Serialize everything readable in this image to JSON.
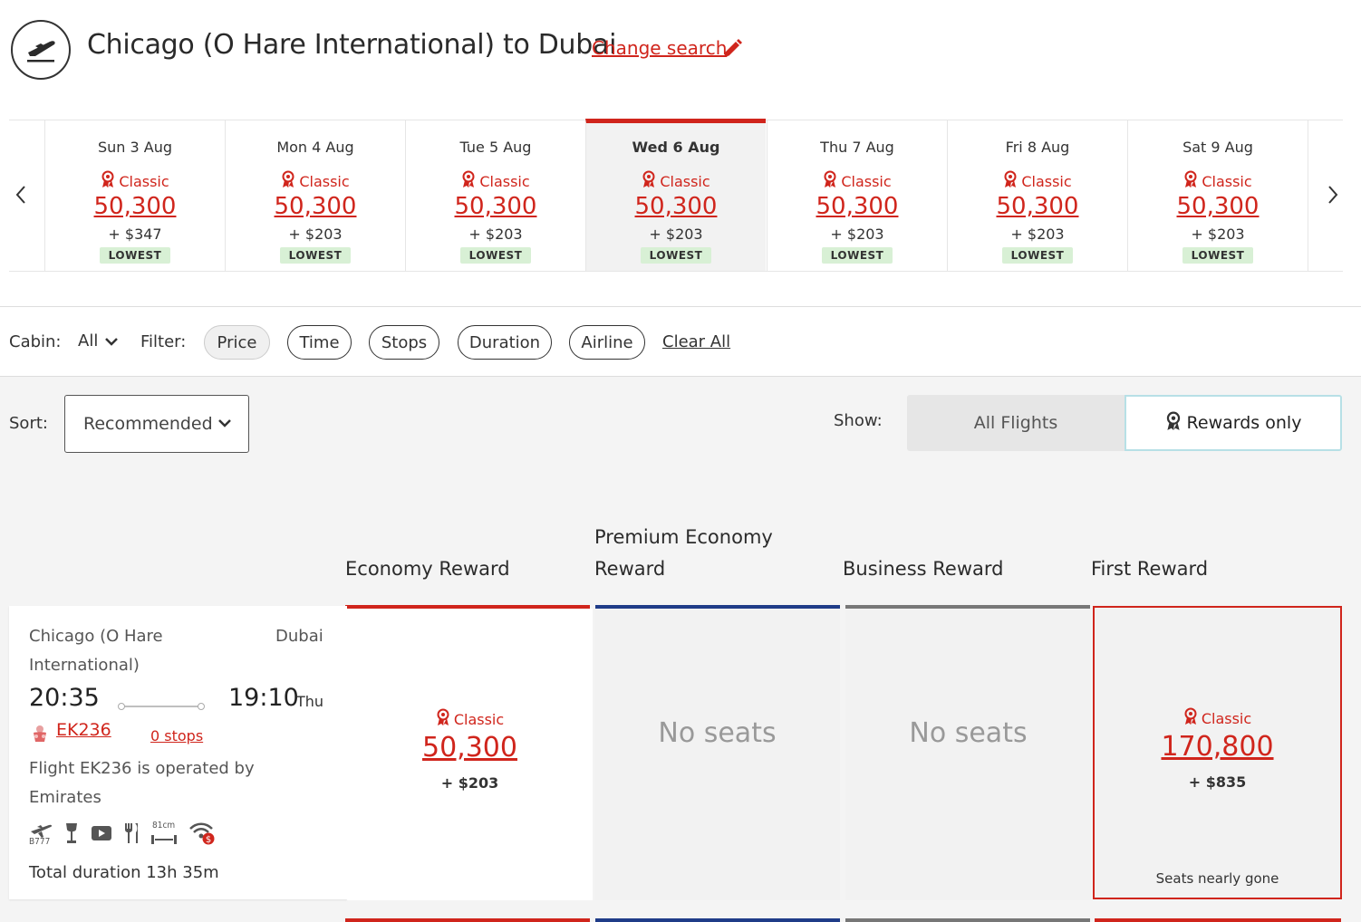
{
  "header": {
    "title": "Chicago (O Hare International) to Dubai",
    "change_search": "Change search"
  },
  "dates": [
    {
      "label": "Sun 3 Aug",
      "award": "Classic",
      "points": "50,300",
      "tax": "+ $347",
      "badge": "LOWEST",
      "selected": false
    },
    {
      "label": "Mon 4 Aug",
      "award": "Classic",
      "points": "50,300",
      "tax": "+ $203",
      "badge": "LOWEST",
      "selected": false
    },
    {
      "label": "Tue 5 Aug",
      "award": "Classic",
      "points": "50,300",
      "tax": "+ $203",
      "badge": "LOWEST",
      "selected": false
    },
    {
      "label": "Wed 6 Aug",
      "award": "Classic",
      "points": "50,300",
      "tax": "+ $203",
      "badge": "LOWEST",
      "selected": true
    },
    {
      "label": "Thu 7 Aug",
      "award": "Classic",
      "points": "50,300",
      "tax": "+ $203",
      "badge": "LOWEST",
      "selected": false
    },
    {
      "label": "Fri 8 Aug",
      "award": "Classic",
      "points": "50,300",
      "tax": "+ $203",
      "badge": "LOWEST",
      "selected": false
    },
    {
      "label": "Sat 9 Aug",
      "award": "Classic",
      "points": "50,300",
      "tax": "+ $203",
      "badge": "LOWEST",
      "selected": false
    }
  ],
  "filters": {
    "cabin_label": "Cabin:",
    "cabin_value": "All",
    "filter_label": "Filter:",
    "pills": [
      "Price",
      "Time",
      "Stops",
      "Duration",
      "Airline"
    ],
    "clear_all": "Clear All"
  },
  "sort": {
    "label": "Sort:",
    "value": "Recommended"
  },
  "show": {
    "label": "Show:",
    "all_flights": "All Flights",
    "rewards_only": "Rewards only"
  },
  "columns": {
    "economy": "Economy Reward",
    "premium_line1": "Premium Economy",
    "premium_line2": "Reward",
    "business": "Business Reward",
    "first": "First Reward"
  },
  "colors": {
    "brand_red": "#d0251c",
    "premium_blue": "#1f3c88",
    "business_grey": "#777777",
    "lowest_green": "#d8f0d5"
  },
  "flight": {
    "origin": "Chicago (O Hare International)",
    "destination": "Dubai",
    "departure": "20:35",
    "arrival": "19:10",
    "arrival_day": "Thu",
    "flight_number": "EK236",
    "stops": "0 stops",
    "operated_by": "Flight EK236 is operated by Emirates",
    "amenities": [
      "B777-aircraft-icon",
      "wine-glass-icon",
      "video-icon",
      "dining-icon",
      "seat-pitch-81cm-icon",
      "paid-wifi-icon"
    ],
    "aircraft_code": "B777",
    "seat_pitch": "81cm",
    "total_duration": "Total duration 13h 35m"
  },
  "fares": {
    "economy": {
      "award": "Classic",
      "points": "50,300",
      "tax": "+ $203"
    },
    "premium": {
      "text": "No seats"
    },
    "business": {
      "text": "No seats"
    },
    "first": {
      "award": "Classic",
      "points": "170,800",
      "tax": "+ $835",
      "note": "Seats nearly gone"
    }
  }
}
